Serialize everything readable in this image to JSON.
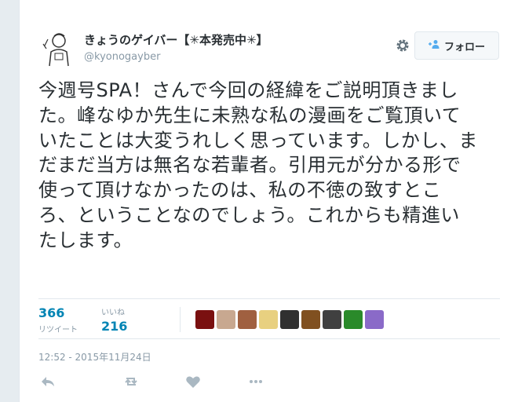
{
  "tweet": {
    "author": {
      "display_name": "きょうのゲイバー【✳本発売中✳】",
      "screen_name": "@kyonogayber"
    },
    "follow_label": "フォロー",
    "text": "今週号SPA！さんで今回の経緯をご説明頂きました。峰なゆか先生に未熟な私の漫画をご覧頂いていたことは大変うれしく思っています。しかし、まだまだ当方は無名な若輩者。引用元が分かる形で使って頂けなかったのは、私の不徳の致すところ、ということなのでしょう。これからも精進いたします。",
    "stats": {
      "retweets": {
        "count": "366",
        "label": "リツイート"
      },
      "likes": {
        "count": "216",
        "label": "いいね"
      }
    },
    "timestamp": "12:52 - 2015年11月24日"
  },
  "favers": [
    {
      "name": "faver-1",
      "color": "#7a1010"
    },
    {
      "name": "faver-2",
      "color": "#c8a890"
    },
    {
      "name": "faver-3",
      "color": "#a06040"
    },
    {
      "name": "faver-4",
      "color": "#e8d080"
    },
    {
      "name": "faver-5",
      "color": "#303030"
    },
    {
      "name": "faver-6",
      "color": "#805020"
    },
    {
      "name": "faver-7",
      "color": "#404040"
    },
    {
      "name": "faver-8",
      "color": "#2a8a2a"
    },
    {
      "name": "faver-9",
      "color": "#8a6ac8"
    }
  ],
  "colors": {
    "accent": "#0084b4",
    "muted": "#8899a6",
    "border": "#e1e8ed"
  },
  "icons": [
    "settings-gear-icon",
    "follow-user-icon",
    "reply-icon",
    "retweet-icon",
    "like-heart-icon",
    "more-icon"
  ]
}
